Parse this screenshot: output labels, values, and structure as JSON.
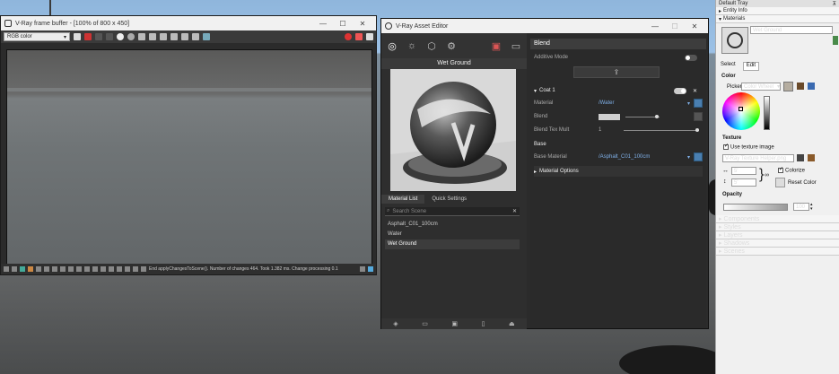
{
  "frame_buffer": {
    "title": "V-Ray frame buffer - [100% of 800 x 450]",
    "channel": "RGB color",
    "status_text": "End applyChangesToScene(). Number of changes 464. Took 1.382 ms. Change processing 0.1"
  },
  "asset_editor": {
    "title": "V-Ray Asset Editor",
    "preview_name": "Wet Ground",
    "tabs": [
      "Material List",
      "Quick Settings"
    ],
    "search_placeholder": "Search Scene",
    "materials": [
      "Asphalt_C01_100cm",
      "Water",
      "Wet Ground"
    ],
    "selected_material": "Wet Ground",
    "blend_header": "Blend",
    "additive_mode_label": "Additive Mode",
    "coat_label": "Coat 1",
    "material_label": "Material",
    "material_value": "/Water",
    "blend_label": "Blend",
    "blend_tex_mult_label": "Blend Tex Mult",
    "blend_tex_mult_value": "1",
    "base_section": "Base",
    "base_material_label": "Base Material",
    "base_material_value": "/Asphalt_C01_100cm",
    "material_options_label": "Material Options"
  },
  "tray": {
    "title": "Default Tray",
    "entity_info": "Entity Info",
    "materials": "Materials",
    "material_name": "Wet Ground",
    "tab_select": "Select",
    "tab_edit": "Edit",
    "color_label": "Color",
    "picker_label": "Picker:",
    "picker_value": "Color Wheel",
    "texture_label": "Texture",
    "use_texture_label": "Use texture image",
    "texture_file": "V-Ray Texture Helper.png",
    "tex_width": "5'",
    "tex_height": "5'",
    "colorize_label": "Colorize",
    "reset_color_label": "Reset Color",
    "opacity_label": "Opacity",
    "opacity_value": "100",
    "sections": [
      "Components",
      "Styles",
      "Layers",
      "Shadows",
      "Scenes"
    ]
  }
}
